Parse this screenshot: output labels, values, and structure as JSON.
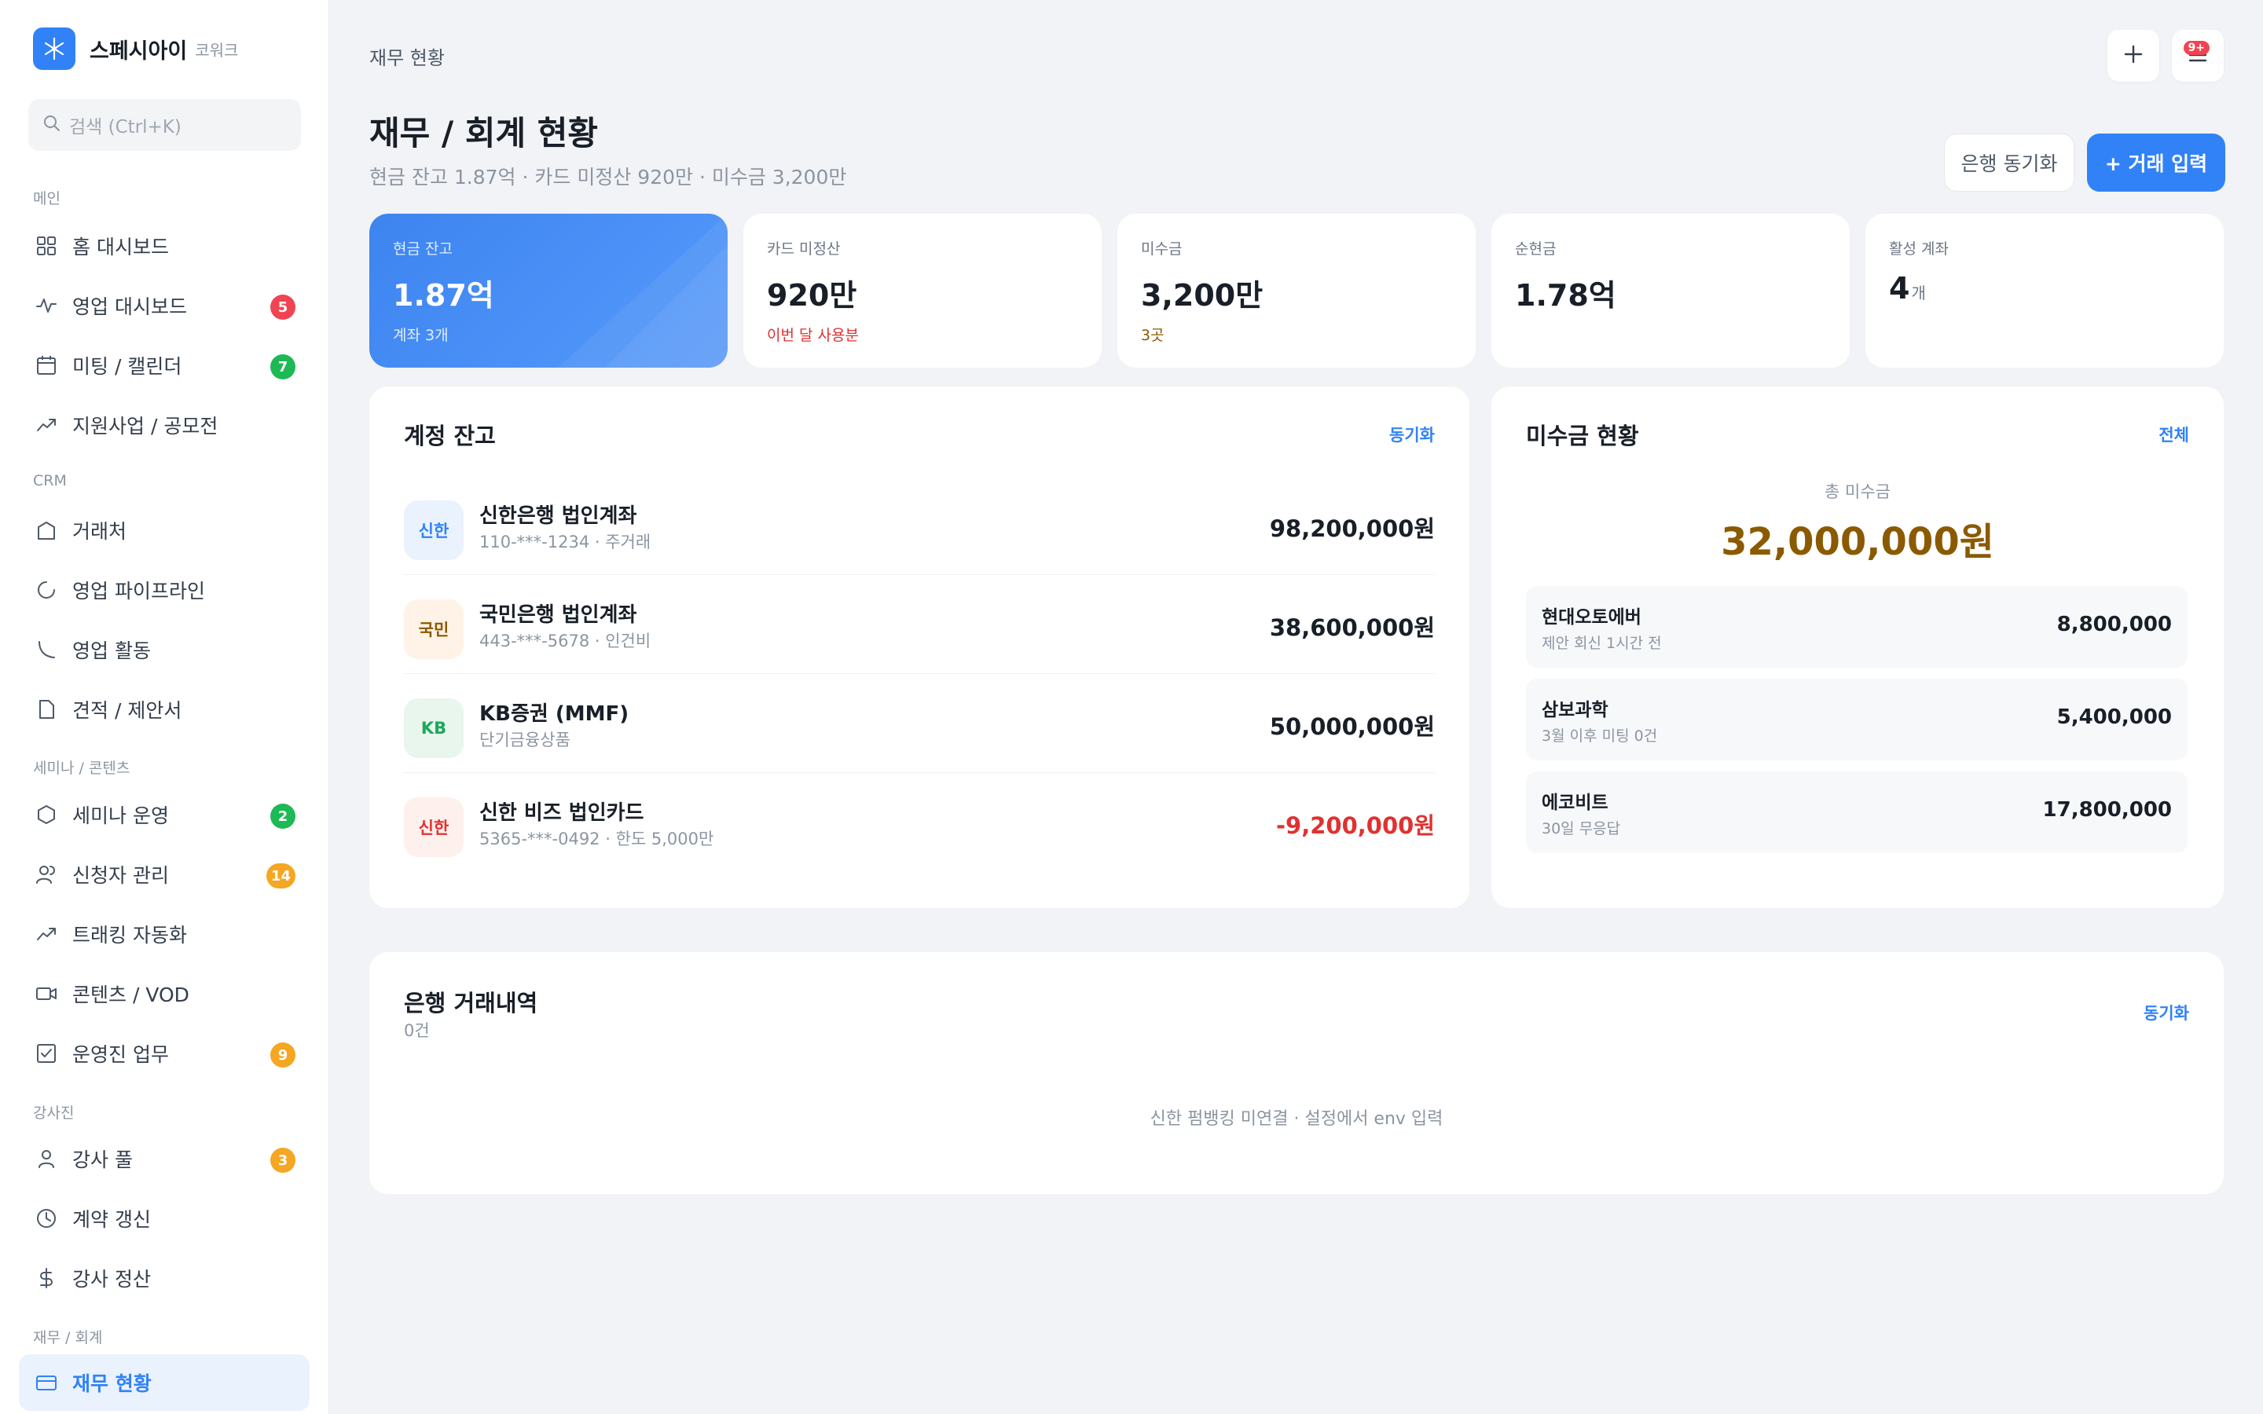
{
  "brand": {
    "name": "스페시아이",
    "sub": "코워크"
  },
  "search": {
    "placeholder": "검색 (Ctrl+K)"
  },
  "sidebar": {
    "sections": [
      {
        "label": "메인"
      },
      {
        "label": "CRM"
      },
      {
        "label": "세미나 / 콘텐츠"
      },
      {
        "label": "강사진"
      },
      {
        "label": "재무 / 회계"
      }
    ],
    "items": [
      {
        "label": "홈 대시보드",
        "icon": "grid-icon"
      },
      {
        "label": "영업 대시보드",
        "icon": "activity-icon",
        "badge": "5",
        "badge_color": "#F04452"
      },
      {
        "label": "미팅 / 캘린더",
        "icon": "calendar-icon",
        "badge": "7",
        "badge_color": "#1DB954"
      },
      {
        "label": "지원사업 / 공모전",
        "icon": "trending-icon"
      },
      {
        "label": "거래처",
        "icon": "building-icon"
      },
      {
        "label": "영업 파이프라인",
        "icon": "pipeline-icon"
      },
      {
        "label": "영업 활동",
        "icon": "phone-icon"
      },
      {
        "label": "견적 / 제안서",
        "icon": "file-icon"
      },
      {
        "label": "세미나 운영",
        "icon": "hexagon-icon",
        "badge": "2",
        "badge_color": "#1DB954"
      },
      {
        "label": "신청자 관리",
        "icon": "users-icon",
        "badge": "14",
        "badge_color": "#F5A623"
      },
      {
        "label": "트래킹 자동화",
        "icon": "trending-icon"
      },
      {
        "label": "콘텐츠 / VOD",
        "icon": "video-icon"
      },
      {
        "label": "운영진 업무",
        "icon": "checkbox-icon",
        "badge": "9",
        "badge_color": "#F5A623"
      },
      {
        "label": "강사 풀",
        "icon": "user-icon",
        "badge": "3",
        "badge_color": "#F5A623"
      },
      {
        "label": "계약 갱신",
        "icon": "clock-icon"
      },
      {
        "label": "강사 정산",
        "icon": "dollar-icon"
      },
      {
        "label": "재무 현황",
        "icon": "card-icon",
        "active": true
      }
    ]
  },
  "header": {
    "breadcrumb": "재무 현황",
    "notif_badge": "9+",
    "title": "재무 / 회계 현황",
    "subtitle": "현금 잔고 1.87억 · 카드 미정산 920만 · 미수금 3,200만",
    "sync_label": "은행 동기화",
    "add_label": "+ 거래 입력"
  },
  "kpis": [
    {
      "label": "현금 잔고",
      "value": "1.87억",
      "sub": "계좌 3개",
      "sub_color": "#E3EEFF"
    },
    {
      "label": "카드 미정산",
      "value": "920만",
      "sub": "이번 달 사용분",
      "sub_color": "#E03131"
    },
    {
      "label": "미수금",
      "value": "3,200만",
      "sub": "3곳",
      "sub_color": "#8B5A00"
    },
    {
      "label": "순현금",
      "value": "1.78억"
    },
    {
      "label": "활성 계좌",
      "value": "4",
      "unit": "개"
    }
  ],
  "accounts": {
    "title": "계정 잔고",
    "link": "동기화",
    "rows": [
      {
        "badge": "신한",
        "badge_bg": "#EAF2FE",
        "badge_fg": "#3182F6",
        "name": "신한은행 법인계좌",
        "sub": "110-***-1234 · 주거래",
        "amount": "98,200,000원",
        "amount_color": "#191F28"
      },
      {
        "badge": "국민",
        "badge_bg": "#FEF3E6",
        "badge_fg": "#8B5A00",
        "name": "국민은행 법인계좌",
        "sub": "443-***-5678 · 인건비",
        "amount": "38,600,000원",
        "amount_color": "#191F28"
      },
      {
        "badge": "KB",
        "badge_bg": "#E8F6EE",
        "badge_fg": "#1DA85A",
        "name": "KB증권 (MMF)",
        "sub": "단기금융상품",
        "amount": "50,000,000원",
        "amount_color": "#191F28"
      },
      {
        "badge": "신한",
        "badge_bg": "#FEF0EC",
        "badge_fg": "#E03131",
        "name": "신한 비즈 법인카드",
        "sub": "5365-***-0492 · 한도 5,000만",
        "amount": "-9,200,000원",
        "amount_color": "#E03131"
      }
    ]
  },
  "receivables": {
    "title": "미수금 현황",
    "link": "전체",
    "total_label": "총 미수금",
    "total": "32,000,000원",
    "total_color": "#8B5A00",
    "rows": [
      {
        "name": "현대오토에버",
        "sub": "제안 회신 1시간 전",
        "amount": "8,800,000"
      },
      {
        "name": "삼보과학",
        "sub": "3월 이후 미팅 0건",
        "amount": "5,400,000"
      },
      {
        "name": "에코비트",
        "sub": "30일 무응답",
        "amount": "17,800,000"
      }
    ]
  },
  "transactions": {
    "title": "은행 거래내역",
    "count": "0건",
    "link": "동기화",
    "empty": "신한 펌뱅킹 미연결 · 설정에서 env 입력"
  }
}
